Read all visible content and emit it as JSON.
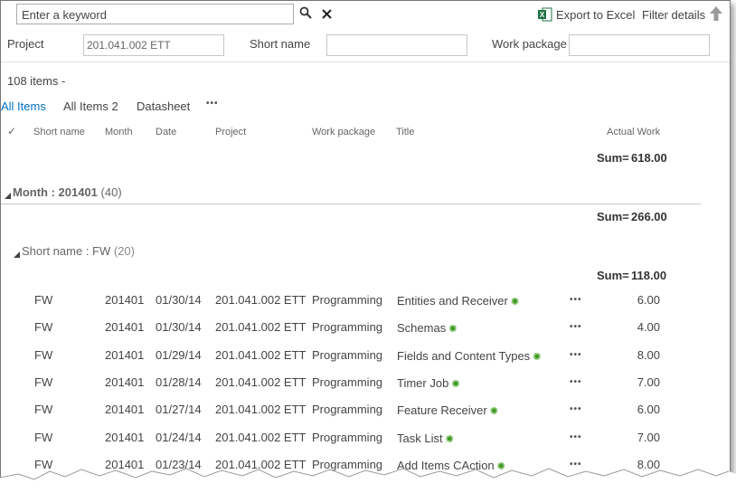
{
  "search": {
    "placeholder": "Enter a keyword",
    "search_icon": "magnifier",
    "clear_icon": "x"
  },
  "toolbar": {
    "export_label": "Export to Excel",
    "filter_label": "Filter details"
  },
  "filters": {
    "project_label": "Project",
    "project_value": "201.041.002 ETT",
    "shortname_label": "Short name",
    "shortname_value": "",
    "workpackage_label": "Work package",
    "workpackage_value": ""
  },
  "item_count": "108 items -",
  "views": [
    {
      "label": "All Items",
      "active": true
    },
    {
      "label": "All Items 2",
      "active": false
    },
    {
      "label": "Datasheet",
      "active": false
    }
  ],
  "more_label": "•••",
  "columns": {
    "check": "✓",
    "shortname": "Short name",
    "month": "Month",
    "date": "Date",
    "project": "Project",
    "workpackage": "Work package",
    "title": "Title",
    "actual": "Actual Work"
  },
  "sums": {
    "label": "Sum=",
    "total": "618.00",
    "month": "266.00",
    "shortname": "118.00"
  },
  "group_month": {
    "label": "Month : 201401",
    "count": "(40)"
  },
  "group_shortname": {
    "label": "Short name : FW",
    "count": "(20)"
  },
  "new_icon_glyph": "✺",
  "rows": [
    {
      "shortname": "FW",
      "month": "201401",
      "date": "01/30/14",
      "project": "201.041.002 ETT",
      "workpackage": "Programming",
      "title": "Entities and Receiver",
      "actual": "6.00"
    },
    {
      "shortname": "FW",
      "month": "201401",
      "date": "01/30/14",
      "project": "201.041.002 ETT",
      "workpackage": "Programming",
      "title": "Schemas",
      "actual": "4.00"
    },
    {
      "shortname": "FW",
      "month": "201401",
      "date": "01/29/14",
      "project": "201.041.002 ETT",
      "workpackage": "Programming",
      "title": "Fields and Content Types",
      "actual": "8.00"
    },
    {
      "shortname": "FW",
      "month": "201401",
      "date": "01/28/14",
      "project": "201.041.002 ETT",
      "workpackage": "Programming",
      "title": "Timer Job",
      "actual": "7.00"
    },
    {
      "shortname": "FW",
      "month": "201401",
      "date": "01/27/14",
      "project": "201.041.002 ETT",
      "workpackage": "Programming",
      "title": "Feature Receiver",
      "actual": "6.00"
    },
    {
      "shortname": "FW",
      "month": "201401",
      "date": "01/24/14",
      "project": "201.041.002 ETT",
      "workpackage": "Programming",
      "title": "Task List",
      "actual": "7.00"
    },
    {
      "shortname": "FW",
      "month": "201401",
      "date": "01/23/14",
      "project": "201.041.002 ETT",
      "workpackage": "Programming",
      "title": "Add Items CAction",
      "actual": "8.00"
    }
  ],
  "colors": {
    "accent": "#0072c6",
    "new_marker": "#3a9a1b",
    "excel": "#1f7244"
  }
}
